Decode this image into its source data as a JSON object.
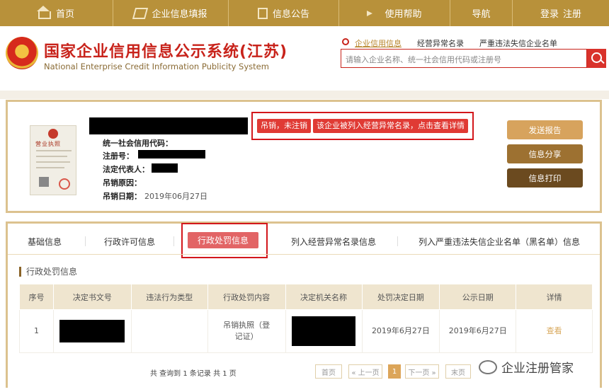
{
  "nav": {
    "home": "首页",
    "report": "企业信息填报",
    "notice": "信息公告",
    "help": "使用帮助",
    "guide": "导航",
    "login": "登录",
    "register": "注册"
  },
  "header": {
    "title_cn": "国家企业信用信息公示系统(江苏)",
    "title_en": "National Enterprise Credit Information Publicity System",
    "search_tabs": [
      "企业信用信息",
      "经营异常名录",
      "严重违法失信企业名单"
    ],
    "search_placeholder": "请输入企业名称、统一社会信用代码或注册号"
  },
  "license": {
    "title": "营业执照"
  },
  "company": {
    "status_badge": "吊销，未注销",
    "abnormal_badge": "该企业被列入经营异常名录，点击查看详情",
    "fields": {
      "credit_code": "统一社会信用代码：",
      "reg_no": "注册号：",
      "legal_rep": "法定代表人：",
      "revoke_reason": "吊销原因：",
      "revoke_date": "吊销日期："
    },
    "revoke_date_value": "2019年06月27日"
  },
  "actions": {
    "send_report": "发送报告",
    "share": "信息分享",
    "print": "信息打印"
  },
  "tabs": [
    "基础信息",
    "行政许可信息",
    "行政处罚信息",
    "列入经营异常名录信息",
    "列入严重违法失信企业名单（黑名单）信息"
  ],
  "active_tab_index": 2,
  "section_title": "行政处罚信息",
  "table": {
    "headers": [
      "序号",
      "决定书文号",
      "违法行为类型",
      "行政处罚内容",
      "决定机关名称",
      "处罚决定日期",
      "公示日期",
      "详情"
    ],
    "rows": [
      {
        "no": "1",
        "doc_no": "",
        "violation": "",
        "content": "吊销执照（登记证）",
        "authority": "",
        "decision_date": "2019年6月27日",
        "publish_date": "2019年6月27日",
        "detail": "查看"
      }
    ]
  },
  "pager": {
    "summary": "共 查询到 1 条记录 共 1 页",
    "first": "首页",
    "prev": "« 上一页",
    "current": "1",
    "next": "下一页 »",
    "last": "末页"
  },
  "watermark": "企业注册管家",
  "colors": {
    "brand_gold": "#b8913a",
    "brand_red": "#c8231b",
    "badge_red": "#e03a34",
    "highlight_box": "#d3171b"
  }
}
